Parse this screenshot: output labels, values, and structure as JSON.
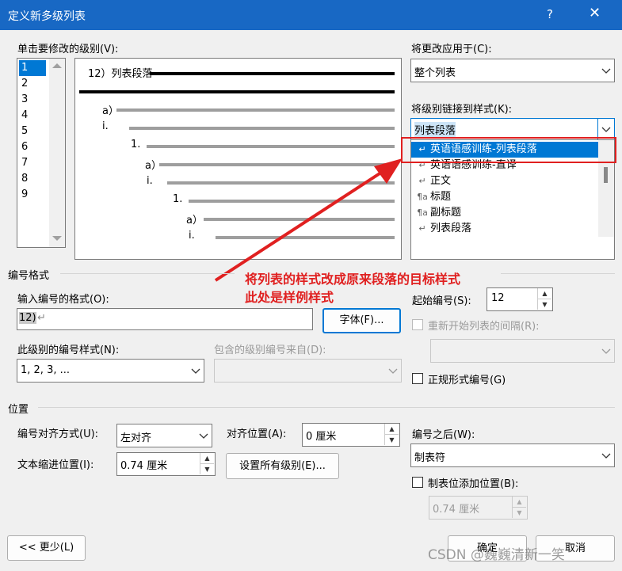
{
  "window": {
    "title": "定义新多级列表",
    "help": "?",
    "close": "✕"
  },
  "level_section": {
    "label": "单击要修改的级别(V):",
    "levels": [
      "1",
      "2",
      "3",
      "4",
      "5",
      "6",
      "7",
      "8",
      "9"
    ],
    "selected": "1"
  },
  "preview": {
    "first_line": "12）列表段落",
    "lines": [
      "a）",
      "i.",
      "1.",
      "a）",
      "i.",
      "1.",
      "a）",
      "i."
    ]
  },
  "apply_to": {
    "label": "将更改应用于(C):",
    "value": "整个列表"
  },
  "link_style": {
    "label": "将级别链接到样式(K):",
    "value": "列表段落",
    "options": [
      {
        "glyph": "↵",
        "text": "英语语感训练-列表段落"
      },
      {
        "glyph": "↵",
        "text": "英语语感训练-直译"
      },
      {
        "glyph": "↵",
        "text": "正文"
      },
      {
        "glyph": "¶a",
        "text": "标题"
      },
      {
        "glyph": "¶a",
        "text": "副标题"
      },
      {
        "glyph": "↵",
        "text": "列表段落"
      }
    ]
  },
  "annotation": {
    "line1": "将列表的样式改成原来段落的目标样式",
    "line2": "此处是样例样式",
    "color": "#e02020"
  },
  "number_format": {
    "section": "编号格式",
    "format_label": "输入编号的格式(O):",
    "format_value": "12)",
    "font_button": "字体(F)...",
    "style_label": "此级别的编号样式(N):",
    "style_value": "1, 2, 3, ...",
    "include_label": "包含的级别编号来自(D):",
    "include_value": "",
    "start_label": "起始编号(S):",
    "start_value": "12",
    "restart_label": "重新开始列表的间隔(R):",
    "restart_value": "",
    "legal_label": "正规形式编号(G)"
  },
  "position": {
    "section": "位置",
    "align_label": "编号对齐方式(U):",
    "align_value": "左对齐",
    "at_label": "对齐位置(A):",
    "at_value": "0 厘米",
    "indent_label": "文本缩进位置(I):",
    "indent_value": "0.74 厘米",
    "set_all": "设置所有级别(E)...",
    "follow_label": "编号之后(W):",
    "follow_value": "制表符",
    "tab_label": "制表位添加位置(B):",
    "tab_value": "0.74 厘米"
  },
  "buttons": {
    "less": "<< 更少(L)",
    "ok": "确定",
    "cancel": "取消"
  },
  "watermark": "CSDN @巍巍清新一笑"
}
